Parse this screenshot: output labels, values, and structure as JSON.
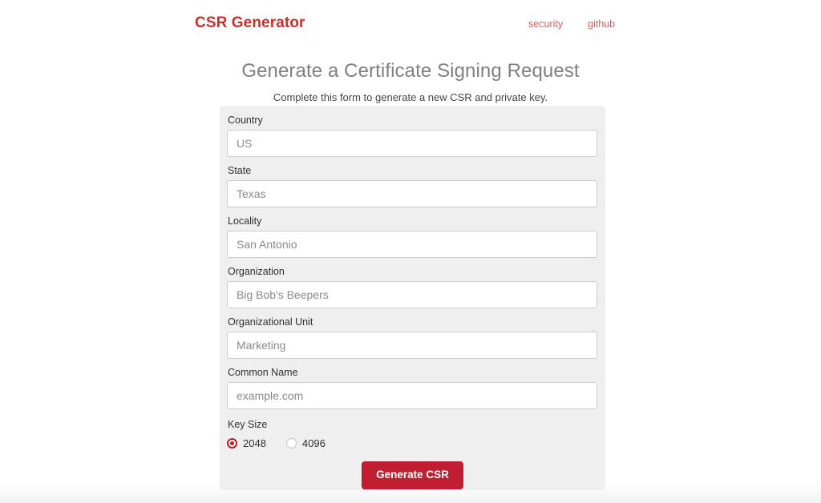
{
  "header": {
    "brand": "CSR Generator",
    "nav": [
      {
        "label": "security"
      },
      {
        "label": "github"
      }
    ]
  },
  "page": {
    "title": "Generate a Certificate Signing Request",
    "subtitle": "Complete this form to generate a new CSR and private key."
  },
  "form": {
    "fields": [
      {
        "label": "Country",
        "value": "US",
        "placeholder": "US"
      },
      {
        "label": "State",
        "value": "Texas",
        "placeholder": "Texas"
      },
      {
        "label": "Locality",
        "value": "San Antonio",
        "placeholder": "San Antonio"
      },
      {
        "label": "Organization",
        "value": "Big Bob's Beepers",
        "placeholder": "Big Bob's Beepers"
      },
      {
        "label": "Organizational Unit",
        "value": "Marketing",
        "placeholder": "Marketing"
      },
      {
        "label": "Common Name",
        "value": "example.com",
        "placeholder": "example.com"
      }
    ],
    "key_size": {
      "label": "Key Size",
      "options": [
        {
          "label": "2048",
          "selected": true
        },
        {
          "label": "4096",
          "selected": false
        }
      ]
    },
    "submit_label": "Generate CSR"
  },
  "colors": {
    "brand_red": "#c9302c",
    "nav_red": "#e05c58",
    "button_red": "#c21e32",
    "radio_red": "#c01a2b",
    "panel_bg": "#efefef",
    "page_bg": "#ffffff"
  }
}
